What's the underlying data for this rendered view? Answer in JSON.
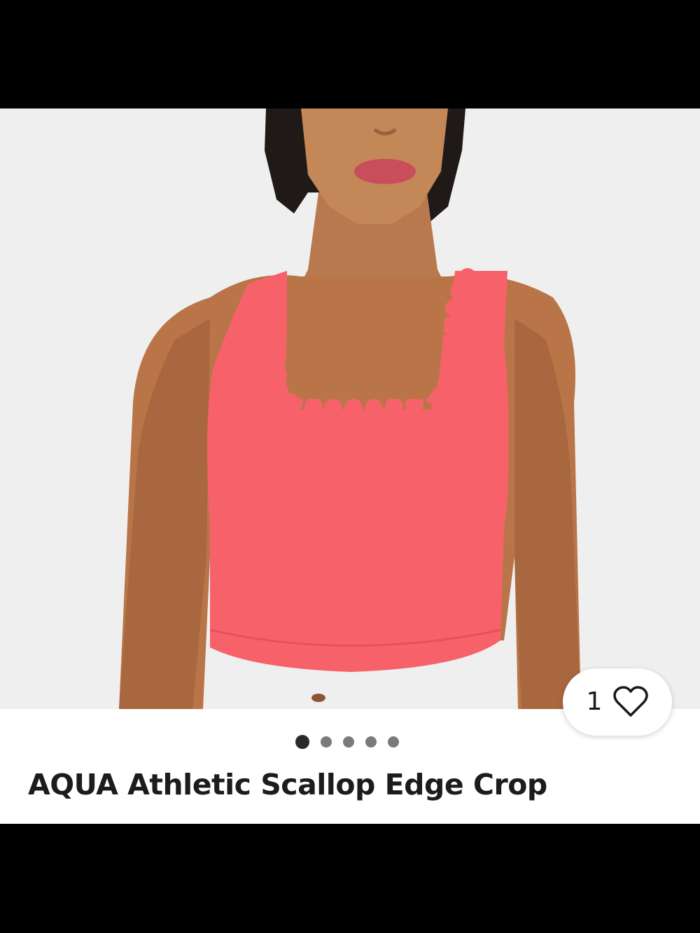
{
  "listing": {
    "title": "AQUA Athletic Scallop Edge Crop",
    "like_count": "1",
    "carousel": {
      "total_images": 5,
      "active_index": 1
    }
  },
  "icons": {
    "like": "heart-outline-icon"
  },
  "colors": {
    "top_color": "#f7626a",
    "background": "#efefef"
  }
}
